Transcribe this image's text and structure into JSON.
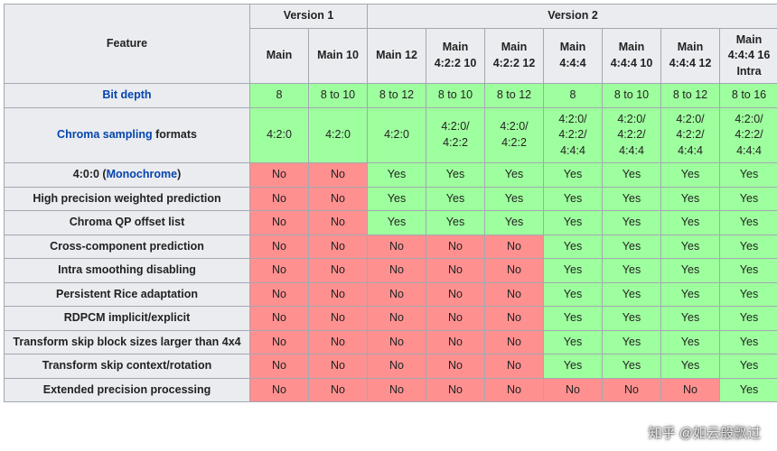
{
  "header": {
    "feature_label": "Feature",
    "version_groups": [
      "Version 1",
      "Version 2"
    ],
    "profiles": [
      "Main",
      "Main 10",
      "Main 12",
      "Main 4:2:2 10",
      "Main 4:2:2 12",
      "Main 4:4:4",
      "Main 4:4:4 10",
      "Main 4:4:4 12",
      "Main 4:4:4 16 Intra"
    ]
  },
  "rows": [
    {
      "label_html": "<span class=\"link\">Bit depth</span>",
      "cells": [
        {
          "v": "8",
          "c": "yes"
        },
        {
          "v": "8 to 10",
          "c": "yes"
        },
        {
          "v": "8 to 12",
          "c": "yes"
        },
        {
          "v": "8 to 10",
          "c": "yes"
        },
        {
          "v": "8 to 12",
          "c": "yes"
        },
        {
          "v": "8",
          "c": "yes"
        },
        {
          "v": "8 to 10",
          "c": "yes"
        },
        {
          "v": "8 to 12",
          "c": "yes"
        },
        {
          "v": "8 to 16",
          "c": "yes"
        }
      ]
    },
    {
      "label_html": "<span class=\"link\">Chroma sampling</span> formats",
      "cells": [
        {
          "v": "4:2:0",
          "c": "yes"
        },
        {
          "v": "4:2:0",
          "c": "yes"
        },
        {
          "v": "4:2:0",
          "c": "yes"
        },
        {
          "v": "4:2:0/\n4:2:2",
          "c": "yes"
        },
        {
          "v": "4:2:0/\n4:2:2",
          "c": "yes"
        },
        {
          "v": "4:2:0/\n4:2:2/\n4:4:4",
          "c": "yes"
        },
        {
          "v": "4:2:0/\n4:2:2/\n4:4:4",
          "c": "yes"
        },
        {
          "v": "4:2:0/\n4:2:2/\n4:4:4",
          "c": "yes"
        },
        {
          "v": "4:2:0/\n4:2:2/\n4:4:4",
          "c": "yes"
        }
      ]
    },
    {
      "label_html": "4:0:0 (<span class=\"link\">Monochrome</span>)",
      "cells": [
        {
          "v": "No",
          "c": "no"
        },
        {
          "v": "No",
          "c": "no"
        },
        {
          "v": "Yes",
          "c": "yes"
        },
        {
          "v": "Yes",
          "c": "yes"
        },
        {
          "v": "Yes",
          "c": "yes"
        },
        {
          "v": "Yes",
          "c": "yes"
        },
        {
          "v": "Yes",
          "c": "yes"
        },
        {
          "v": "Yes",
          "c": "yes"
        },
        {
          "v": "Yes",
          "c": "yes"
        }
      ]
    },
    {
      "label_html": "High precision weighted prediction",
      "cells": [
        {
          "v": "No",
          "c": "no"
        },
        {
          "v": "No",
          "c": "no"
        },
        {
          "v": "Yes",
          "c": "yes"
        },
        {
          "v": "Yes",
          "c": "yes"
        },
        {
          "v": "Yes",
          "c": "yes"
        },
        {
          "v": "Yes",
          "c": "yes"
        },
        {
          "v": "Yes",
          "c": "yes"
        },
        {
          "v": "Yes",
          "c": "yes"
        },
        {
          "v": "Yes",
          "c": "yes"
        }
      ]
    },
    {
      "label_html": "Chroma QP offset list",
      "cells": [
        {
          "v": "No",
          "c": "no"
        },
        {
          "v": "No",
          "c": "no"
        },
        {
          "v": "Yes",
          "c": "yes"
        },
        {
          "v": "Yes",
          "c": "yes"
        },
        {
          "v": "Yes",
          "c": "yes"
        },
        {
          "v": "Yes",
          "c": "yes"
        },
        {
          "v": "Yes",
          "c": "yes"
        },
        {
          "v": "Yes",
          "c": "yes"
        },
        {
          "v": "Yes",
          "c": "yes"
        }
      ]
    },
    {
      "label_html": "Cross-component prediction",
      "cells": [
        {
          "v": "No",
          "c": "no"
        },
        {
          "v": "No",
          "c": "no"
        },
        {
          "v": "No",
          "c": "no"
        },
        {
          "v": "No",
          "c": "no"
        },
        {
          "v": "No",
          "c": "no"
        },
        {
          "v": "Yes",
          "c": "yes"
        },
        {
          "v": "Yes",
          "c": "yes"
        },
        {
          "v": "Yes",
          "c": "yes"
        },
        {
          "v": "Yes",
          "c": "yes"
        }
      ]
    },
    {
      "label_html": "Intra smoothing disabling",
      "cells": [
        {
          "v": "No",
          "c": "no"
        },
        {
          "v": "No",
          "c": "no"
        },
        {
          "v": "No",
          "c": "no"
        },
        {
          "v": "No",
          "c": "no"
        },
        {
          "v": "No",
          "c": "no"
        },
        {
          "v": "Yes",
          "c": "yes"
        },
        {
          "v": "Yes",
          "c": "yes"
        },
        {
          "v": "Yes",
          "c": "yes"
        },
        {
          "v": "Yes",
          "c": "yes"
        }
      ]
    },
    {
      "label_html": "Persistent Rice adaptation",
      "cells": [
        {
          "v": "No",
          "c": "no"
        },
        {
          "v": "No",
          "c": "no"
        },
        {
          "v": "No",
          "c": "no"
        },
        {
          "v": "No",
          "c": "no"
        },
        {
          "v": "No",
          "c": "no"
        },
        {
          "v": "Yes",
          "c": "yes"
        },
        {
          "v": "Yes",
          "c": "yes"
        },
        {
          "v": "Yes",
          "c": "yes"
        },
        {
          "v": "Yes",
          "c": "yes"
        }
      ]
    },
    {
      "label_html": "RDPCM implicit/explicit",
      "cells": [
        {
          "v": "No",
          "c": "no"
        },
        {
          "v": "No",
          "c": "no"
        },
        {
          "v": "No",
          "c": "no"
        },
        {
          "v": "No",
          "c": "no"
        },
        {
          "v": "No",
          "c": "no"
        },
        {
          "v": "Yes",
          "c": "yes"
        },
        {
          "v": "Yes",
          "c": "yes"
        },
        {
          "v": "Yes",
          "c": "yes"
        },
        {
          "v": "Yes",
          "c": "yes"
        }
      ]
    },
    {
      "label_html": "Transform skip block sizes larger than 4x4",
      "cells": [
        {
          "v": "No",
          "c": "no"
        },
        {
          "v": "No",
          "c": "no"
        },
        {
          "v": "No",
          "c": "no"
        },
        {
          "v": "No",
          "c": "no"
        },
        {
          "v": "No",
          "c": "no"
        },
        {
          "v": "Yes",
          "c": "yes"
        },
        {
          "v": "Yes",
          "c": "yes"
        },
        {
          "v": "Yes",
          "c": "yes"
        },
        {
          "v": "Yes",
          "c": "yes"
        }
      ]
    },
    {
      "label_html": "Transform skip context/rotation",
      "cells": [
        {
          "v": "No",
          "c": "no"
        },
        {
          "v": "No",
          "c": "no"
        },
        {
          "v": "No",
          "c": "no"
        },
        {
          "v": "No",
          "c": "no"
        },
        {
          "v": "No",
          "c": "no"
        },
        {
          "v": "Yes",
          "c": "yes"
        },
        {
          "v": "Yes",
          "c": "yes"
        },
        {
          "v": "Yes",
          "c": "yes"
        },
        {
          "v": "Yes",
          "c": "yes"
        }
      ]
    },
    {
      "label_html": "Extended precision processing",
      "cells": [
        {
          "v": "No",
          "c": "no"
        },
        {
          "v": "No",
          "c": "no"
        },
        {
          "v": "No",
          "c": "no"
        },
        {
          "v": "No",
          "c": "no"
        },
        {
          "v": "No",
          "c": "no"
        },
        {
          "v": "No",
          "c": "no"
        },
        {
          "v": "No",
          "c": "no"
        },
        {
          "v": "No",
          "c": "no"
        },
        {
          "v": "Yes",
          "c": "yes"
        }
      ]
    }
  ],
  "watermark": "知乎 @如云般飘过"
}
